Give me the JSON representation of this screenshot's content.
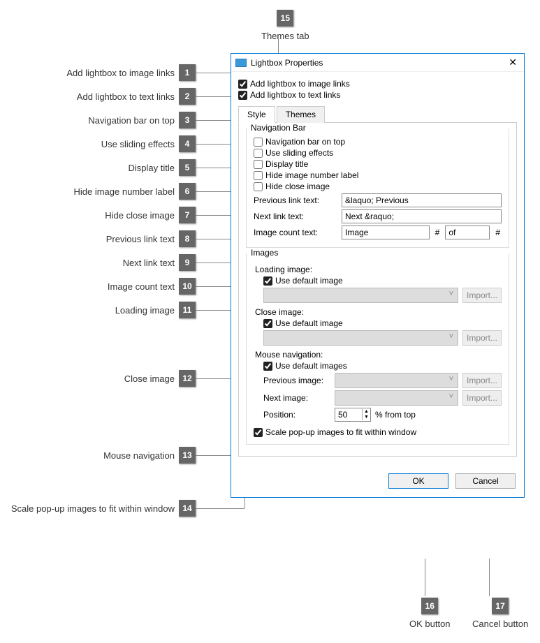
{
  "annotations": {
    "1": "Add lightbox to image links",
    "2": "Add lightbox to text links",
    "3": "Navigation bar on top",
    "4": "Use sliding effects",
    "5": "Display title",
    "6": "Hide image number label",
    "7": "Hide close image",
    "8": "Previous link text",
    "9": "Next link text",
    "10": "Image count text",
    "11": "Loading image",
    "12": "Close image",
    "13": "Mouse navigation",
    "14": "Scale pop-up images to fit within window",
    "15": "Themes tab",
    "16": "OK button",
    "17": "Cancel button"
  },
  "dialog": {
    "title": "Lightbox Properties",
    "top": {
      "add_image_links": "Add lightbox to image links",
      "add_text_links": "Add lightbox to text links"
    },
    "tabs": {
      "style": "Style",
      "themes": "Themes"
    },
    "nav": {
      "legend": "Navigation Bar",
      "on_top": "Navigation bar on top",
      "sliding": "Use sliding effects",
      "title": "Display title",
      "hide_num": "Hide image number label",
      "hide_close": "Hide close image",
      "prev_lbl": "Previous link text:",
      "prev_val": "&laquo; Previous",
      "next_lbl": "Next link text:",
      "next_val": "Next &raquo;",
      "count_lbl": "Image count text:",
      "count_val1": "Image",
      "count_sep": "#",
      "count_val2": "of"
    },
    "images": {
      "legend": "Images",
      "loading_lbl": "Loading image:",
      "use_default": "Use default image",
      "close_lbl": "Close image:",
      "mouse_lbl": "Mouse navigation:",
      "use_defaults": "Use default images",
      "prev_img": "Previous image:",
      "next_img": "Next image:",
      "position": "Position:",
      "pos_val": "50",
      "pos_suffix": "% from top",
      "import": "Import...",
      "scale": "Scale pop-up images to fit within window"
    },
    "buttons": {
      "ok": "OK",
      "cancel": "Cancel"
    }
  }
}
